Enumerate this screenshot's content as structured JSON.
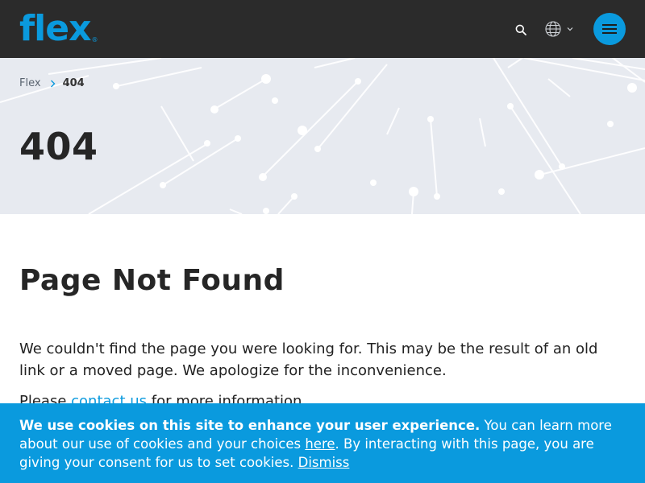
{
  "header": {
    "logo_text": "flex",
    "logo_mark": "®",
    "icons": [
      "search-icon",
      "globe-icon",
      "chevron-down-icon",
      "hamburger-menu-icon"
    ]
  },
  "breadcrumb": {
    "home": "Flex",
    "current": "404"
  },
  "hero": {
    "title": "404"
  },
  "main": {
    "heading": "Page Not Found",
    "body": "We couldn't find the page you were looking for. This may be the result of an old link or a moved page. We apologize for the inconvenience.",
    "more_prefix": "Please ",
    "more_link": "contact us",
    "more_suffix": " for more information."
  },
  "cookie": {
    "strong": "We use cookies on this site to enhance your user experience.",
    "text_1": " You can learn more about our use of cookies and your choices ",
    "here_link": "here",
    "text_2": ". By interacting with this page, you are giving your consent for us to set cookies. ",
    "dismiss_link": "Dismiss"
  },
  "colors": {
    "brand": "#0a9ade",
    "header_bg": "#2b2b2b",
    "hero_bg": "#e7eaf0",
    "text": "#222222"
  }
}
